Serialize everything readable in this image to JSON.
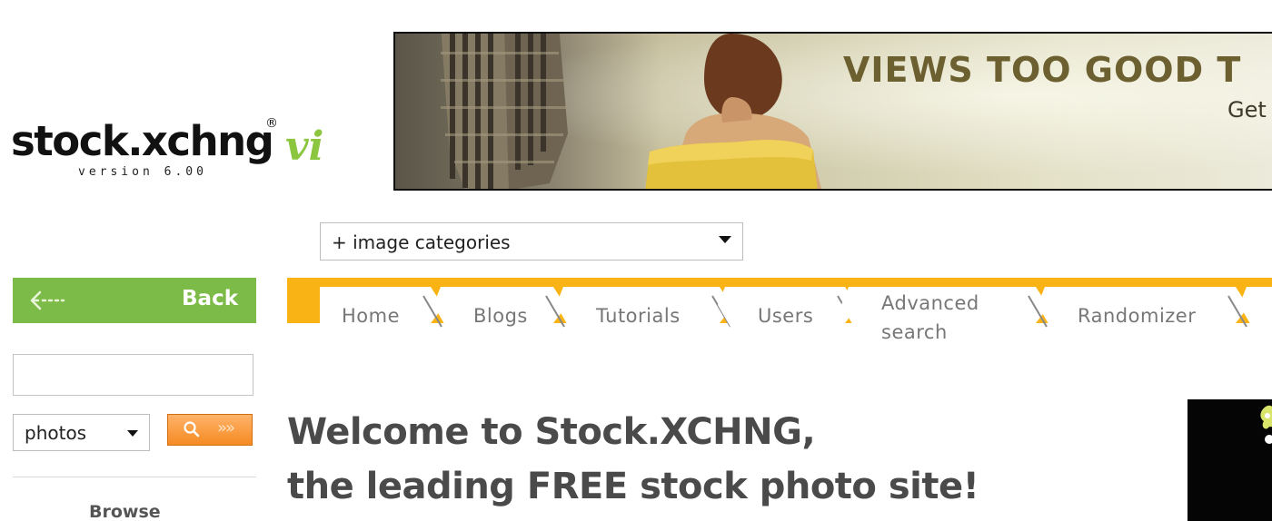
{
  "logo": {
    "wordmark": "stock.xchng",
    "registered": "®",
    "version_mark": "vi",
    "version_text": "version 6.00"
  },
  "banner": {
    "headline": "VIEWS TOO GOOD T",
    "subline": "Get"
  },
  "category_select": {
    "selected": "+ image categories"
  },
  "sidebar": {
    "back_label": "Back",
    "search_placeholder": "",
    "type_select": {
      "selected": "photos"
    },
    "browse_label": "Browse"
  },
  "nav": {
    "tabs": [
      {
        "label": "Home"
      },
      {
        "label": "Blogs"
      },
      {
        "label": "Tutorials"
      },
      {
        "label": "Users"
      },
      {
        "label": "Advanced search"
      },
      {
        "label": "Randomizer"
      }
    ]
  },
  "main": {
    "welcome_line1": "Welcome to Stock.XCHNG,",
    "welcome_line2": "the leading FREE stock photo site!"
  },
  "colors": {
    "nav_orange": "#f9b314",
    "back_green": "#7cbb47",
    "search_orange": "#f58a22",
    "logo_green": "#8cc63f"
  }
}
